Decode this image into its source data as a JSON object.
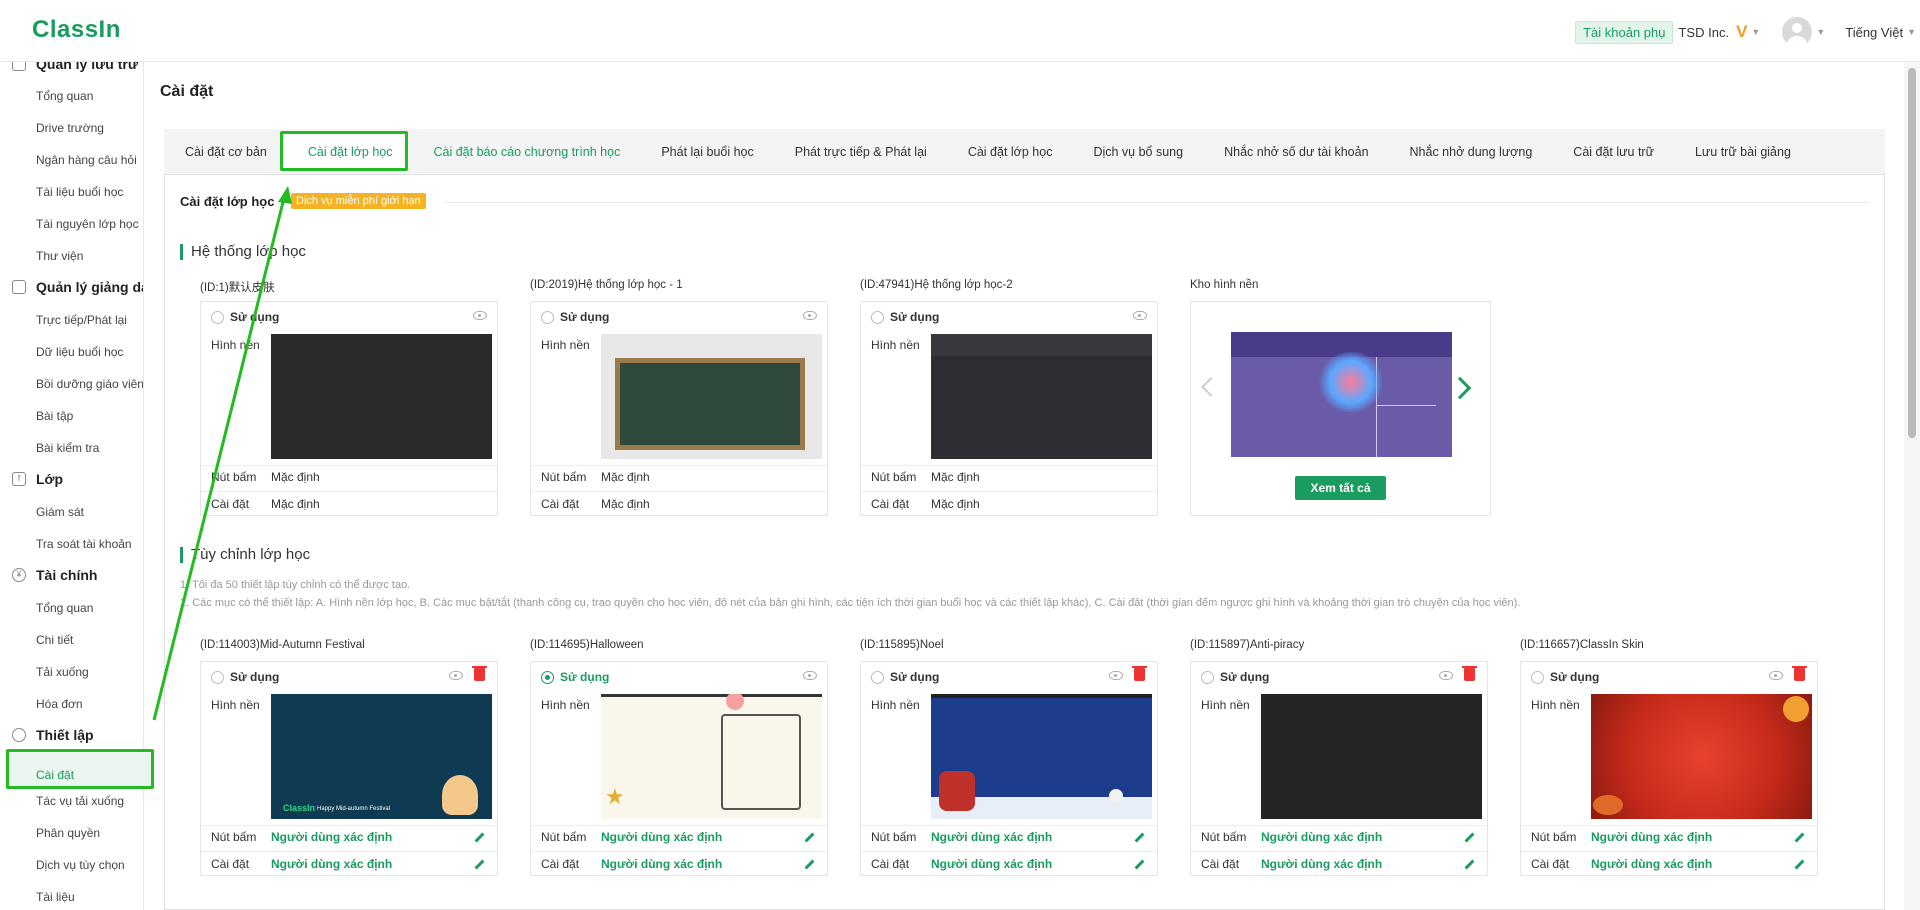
{
  "header": {
    "logo": "ClassIn",
    "sub_account": "Tài khoản phụ",
    "org": "TSD Inc.",
    "vip_mark": "V",
    "language": "Tiếng Việt"
  },
  "sidebar": {
    "top_cut": "Quản lý lưu trữ",
    "storage_items": [
      "Tổng quan",
      "Drive trường",
      "Ngân hàng câu hỏi",
      "Tài liệu buổi học",
      "Tài nguyên lớp học",
      "Thư viện"
    ],
    "teaching_title": "Quản lý giảng dạ",
    "teaching_items": [
      "Trực tiếp/Phát lại",
      "Dữ liệu buổi học",
      "Bồi dưỡng giáo viên",
      "Bài tập",
      "Bài kiểm tra"
    ],
    "class_title": "Lớp",
    "class_items": [
      "Giám sát",
      "Tra soát tài khoản"
    ],
    "finance_title": "Tài chính",
    "finance_items": [
      "Tổng quan",
      "Chi tiết",
      "Tải xuống",
      "Hóa đơn"
    ],
    "settings_title": "Thiết lập",
    "settings_items": [
      "Cài đặt",
      "Tác vụ tải xuống",
      "Phân quyền",
      "Dịch vụ tùy chọn",
      "Tài liệu"
    ]
  },
  "page": {
    "title": "Cài đặt",
    "tabs": [
      "Cài đặt cơ bản",
      "Cài đặt lớp học",
      "Cài đặt báo cáo chương trình học",
      "Phát lại buổi học",
      "Phát trực tiếp & Phát lại",
      "Cài đặt lớp học",
      "Dịch vụ bổ sung",
      "Nhắc nhở số dư tài khoản",
      "Nhắc nhở dung lượng",
      "Cài đặt lưu trữ",
      "Lưu trữ bài giảng"
    ],
    "section_heading": "Cài đặt lớp học",
    "free_badge": "Dịch vụ miễn phí giới hạn",
    "system_title": "Hệ thống lớp học",
    "custom_title": "Tùy chỉnh lớp học",
    "notes": [
      "1. Tối đa 50 thiết lập tùy chỉnh có thể được tạo.",
      "2. Các mục có thể thiết lập: A. Hình nền lớp học, B. Các mục bật/tắt (thanh công cụ, trao quyền cho học viên, độ nét của bản ghi hình, các tiện ích thời gian buổi học và các thiết lập khác), C. Cài đặt (thời gian đếm ngược ghi hình và khoảng thời gian trò chuyện của học viên)."
    ],
    "use_label": "Sử dụng",
    "bg_label": "Hình nền",
    "btn_label": "Nút bấm",
    "set_label": "Cài đặt",
    "default_value": "Mặc định",
    "user_defined": "Người dùng xác định",
    "library_title": "Kho hình nền",
    "view_all": "Xem tất cả"
  },
  "system_cards": [
    {
      "id_label": "(ID:1)默认皮肤",
      "selected": false
    },
    {
      "id_label": "(ID:2019)Hệ thống lớp học - 1",
      "selected": false
    },
    {
      "id_label": "(ID:47941)Hệ thống lớp học-2",
      "selected": false
    }
  ],
  "custom_cards": [
    {
      "id_label": "(ID:114003)Mid-Autumn Festival",
      "selected": false,
      "thumb_text": "ClassIn",
      "thumb_sub": "Happy Mid-autumn Festival"
    },
    {
      "id_label": "(ID:114695)Halloween",
      "selected": true,
      "thumb_text": "",
      "thumb_sub": ""
    },
    {
      "id_label": "(ID:115895)Noel",
      "selected": false,
      "thumb_text": "",
      "thumb_sub": ""
    },
    {
      "id_label": "(ID:115897)Anti-piracy",
      "selected": false,
      "thumb_text": "",
      "thumb_sub": ""
    },
    {
      "id_label": "(ID:116657)ClassIn Skin",
      "selected": false,
      "thumb_text": "",
      "thumb_sub": ""
    }
  ],
  "colors": {
    "brand": "#1a9b5f",
    "highlight": "#22bb22",
    "badge": "#f5b324",
    "danger": "#e33333"
  }
}
